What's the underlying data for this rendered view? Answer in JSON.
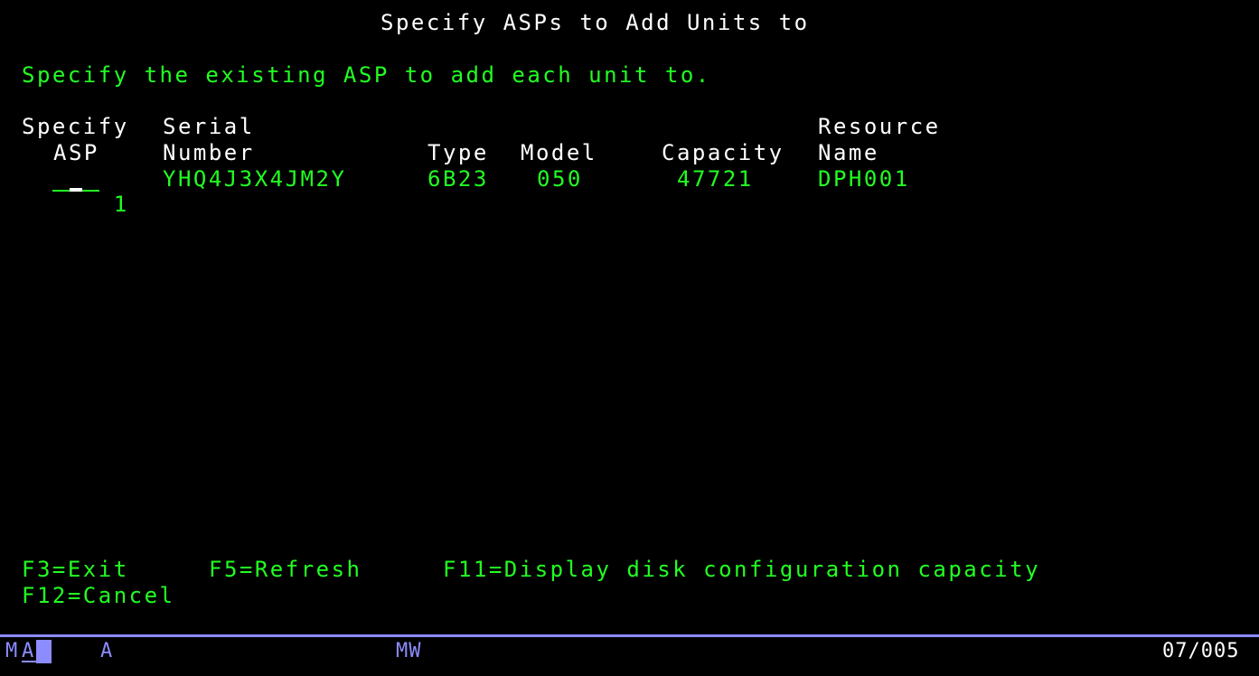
{
  "screen": {
    "title": "Specify ASPs to Add Units to",
    "instruction": "Specify the existing ASP to add each unit to."
  },
  "columns": {
    "specify_asp_line1": "Specify",
    "specify_asp_line2": "ASP",
    "serial_line1": "Serial",
    "serial_line2": "Number",
    "type": "Type",
    "model": "Model",
    "capacity": "Capacity",
    "resource_line1": "Resource",
    "resource_line2": "Name"
  },
  "rows": [
    {
      "asp": "1",
      "serial": "YHQ4J3X4JM2Y",
      "type": "6B23",
      "model": "050",
      "capacity": "47721",
      "resource": "DPH001"
    }
  ],
  "function_keys": {
    "f3": "F3=Exit",
    "f5": "F5=Refresh",
    "f11": "F11=Display disk configuration capacity",
    "f12": "F12=Cancel"
  },
  "status_bar": {
    "session_m": "M",
    "session_a": "A",
    "input_mode": "A",
    "mode": "MW",
    "cursor_position": "07/005"
  },
  "colors": {
    "background": "#000000",
    "normal_text": "#22ff22",
    "highlight_text": "#ffffff",
    "status_text": "#8c8cff"
  }
}
